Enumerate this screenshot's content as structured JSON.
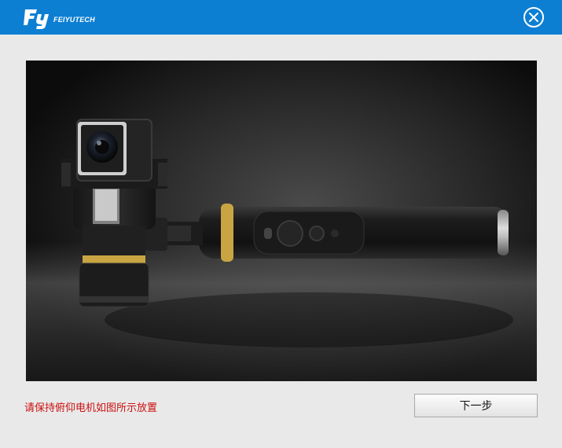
{
  "brand": {
    "wordmark": "FEIYUTECH",
    "logo_monogram": "Fy",
    "logo_icon": "feiyutech-logo-icon"
  },
  "window": {
    "close_icon": "close-circle-icon"
  },
  "product_image": {
    "subject": "gimbal-with-action-camera-photo"
  },
  "instruction": {
    "text": "请保持俯仰电机如图所示放置"
  },
  "buttons": {
    "next_label": "下一步"
  },
  "colors": {
    "title_bar": "#0d7fd3",
    "background": "#e9e9e9",
    "instruction_text": "#cc1010",
    "accent_ring": "#c8a442"
  }
}
